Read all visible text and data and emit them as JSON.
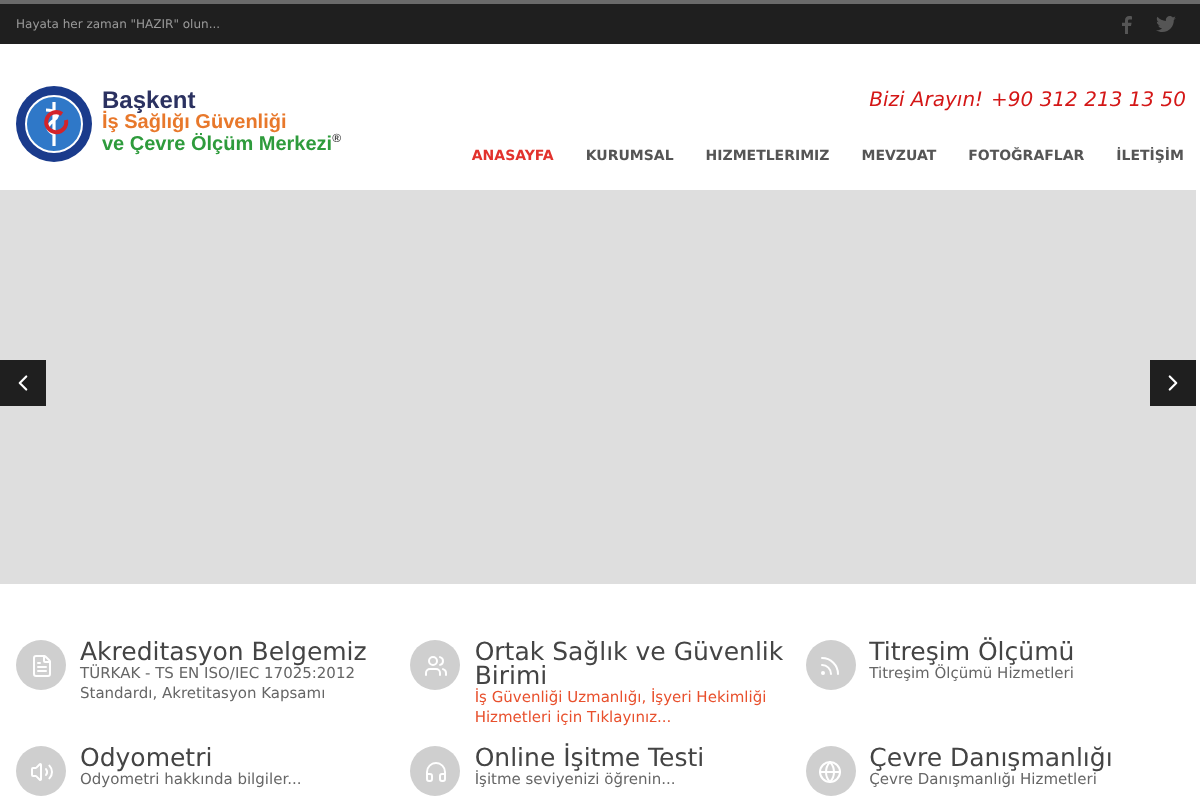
{
  "top_bar": {
    "tagline": "Hayata her zaman \"HAZIR\" olun..."
  },
  "logo": {
    "line_1": "Başkent",
    "line_2": "İş Sağlığı Güvenliği",
    "line_3": "ve Çevre Ölçüm Merkezi",
    "mark": "®"
  },
  "contact": {
    "label": "Bizi Arayın!",
    "phone": "+90 312 213 13 50"
  },
  "nav": [
    {
      "label": "ANASAYFA",
      "selected": true
    },
    {
      "label": "KURUMSAL",
      "selected": false
    },
    {
      "label": "HIZMETLERIMIZ",
      "selected": false
    },
    {
      "label": "MEVZUAT",
      "selected": false
    },
    {
      "label": "FOTOĞRAFLAR",
      "selected": false
    },
    {
      "label": "İLETİŞİM",
      "selected": false
    }
  ],
  "features": [
    {
      "kind": "document",
      "title": "Akreditasyon Belgemiz",
      "lines": [
        "TÜRKAK - TS EN ISO/IEC 17025:2012",
        "Standardı, Akretitasyon Kapsamı"
      ],
      "highlight": false
    },
    {
      "kind": "users",
      "title": "Ortak Sağlık ve Güvenlik Birimi",
      "lines": [
        "İş Güvenliği Uzmanlığı, İşyeri Hekimliği Hizmetleri için Tıklayınız..."
      ],
      "highlight": true
    },
    {
      "kind": "rss",
      "title": "Titreşim Ölçümü",
      "lines": [
        "Titreşim Ölçümü Hizmetleri"
      ],
      "highlight": false
    },
    {
      "kind": "speaker",
      "title": "Odyometri",
      "lines": [
        "Odyometri hakkında bilgiler..."
      ],
      "highlight": false
    },
    {
      "kind": "headphones",
      "title": "Online İşitme Testi",
      "lines": [
        "İşitme seviyenizi öğrenin..."
      ],
      "highlight": false
    },
    {
      "kind": "globe",
      "title": "Çevre Danışmanlığı",
      "lines": [
        "Çevre Danışmanlığı Hizmetleri"
      ],
      "highlight": false
    }
  ]
}
